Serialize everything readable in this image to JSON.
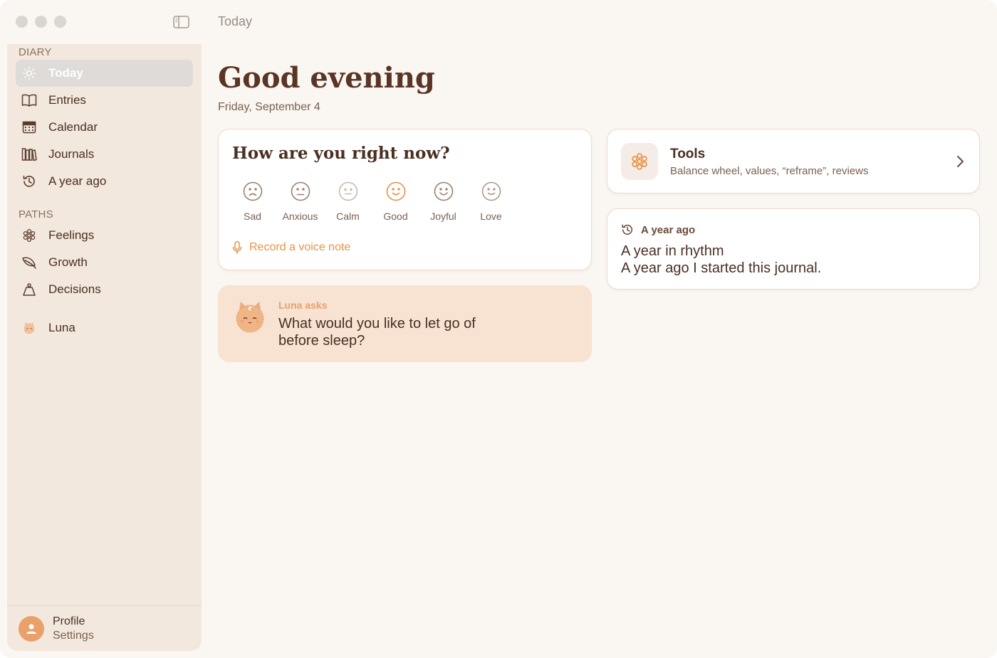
{
  "window": {
    "title": "Today"
  },
  "sidebar": {
    "sections": [
      {
        "label": "DIARY"
      },
      {
        "label": "PATHS"
      }
    ],
    "items": [
      {
        "label": "Today",
        "icon": "sun-icon",
        "active": true
      },
      {
        "label": "Entries",
        "icon": "book-icon"
      },
      {
        "label": "Calendar",
        "icon": "calendar-icon"
      },
      {
        "label": "Journals",
        "icon": "journals-icon"
      },
      {
        "label": "A year ago",
        "icon": "history-icon"
      },
      {
        "label": "Feelings",
        "icon": "flower-icon"
      },
      {
        "label": "Growth",
        "icon": "leaf-icon"
      },
      {
        "label": "Decisions",
        "icon": "weight-icon"
      },
      {
        "label": "Luna",
        "icon": "luna-icon"
      }
    ],
    "profile": {
      "name": "Profile",
      "sub": "Settings"
    }
  },
  "main": {
    "greeting": "Good evening",
    "date": "Friday, September 4",
    "mood_card": {
      "title": "How are you right now?",
      "moods": [
        {
          "label": "Sad",
          "icon": "sad-face-icon"
        },
        {
          "label": "Anxious",
          "icon": "anxious-face-icon"
        },
        {
          "label": "Calm",
          "icon": "calm-face-icon"
        },
        {
          "label": "Good",
          "icon": "good-face-icon",
          "selected": true
        },
        {
          "label": "Joyful",
          "icon": "joyful-face-icon"
        },
        {
          "label": "Love",
          "icon": "love-face-icon"
        }
      ],
      "voice_note": "Record a voice note"
    },
    "luna_card": {
      "asks": "Luna asks",
      "question": "What would you like to let go of before sleep?"
    },
    "tools_card": {
      "title": "Tools",
      "subtitle": "Balance wheel, values, “reframe”, reviews"
    },
    "year_ago_card": {
      "heading": "A year ago",
      "title": "A year in rhythm",
      "body": "A year ago I started this journal."
    }
  },
  "colors": {
    "accent": "#e89246",
    "background": "#faf6f1",
    "sidebar": "#f3e8de",
    "text": "#4a2f22",
    "luna_bg": "#f8e2d2"
  }
}
